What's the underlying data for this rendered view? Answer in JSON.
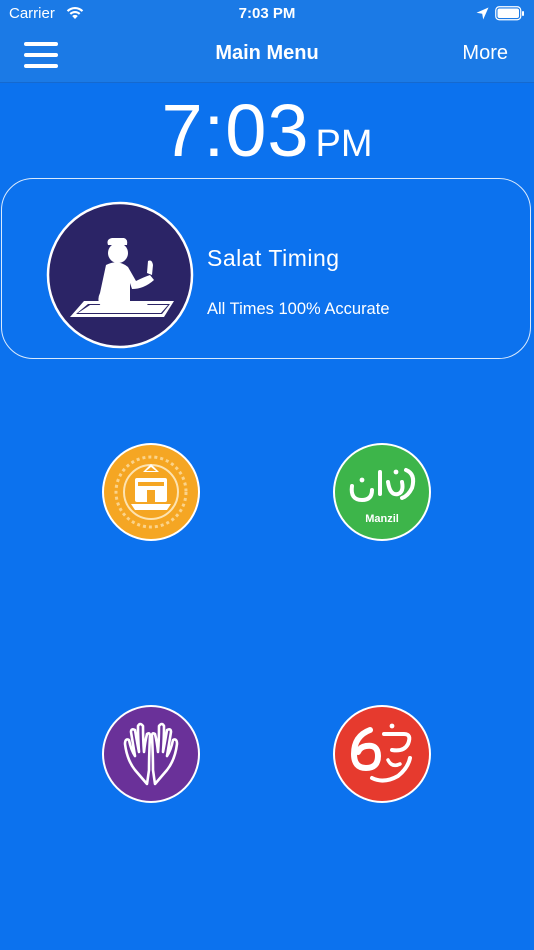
{
  "status_bar": {
    "carrier": "Carrier",
    "time": "7:03 PM"
  },
  "nav": {
    "title": "Main Menu",
    "more_label": "More",
    "menu_icon": "hamburger-menu-icon"
  },
  "clock": {
    "time": "7:03",
    "ampm": "PM"
  },
  "salat_card": {
    "title": "Salat Timing",
    "subtitle": "All Times 100% Accurate",
    "icon": "praying-man-icon"
  },
  "menu_icons": [
    {
      "name": "kaaba-icon",
      "color": "#f5a623"
    },
    {
      "name": "manzil-icon",
      "label": "Manzil",
      "color": "#3db54a"
    },
    {
      "name": "dua-hands-icon",
      "color": "#6a3199"
    },
    {
      "name": "kalma-six-icon",
      "color": "#e63a2e"
    }
  ],
  "colors": {
    "background": "#0c72ee",
    "bar": "#1b7ae6",
    "salat_icon_bg": "#2b2466"
  }
}
